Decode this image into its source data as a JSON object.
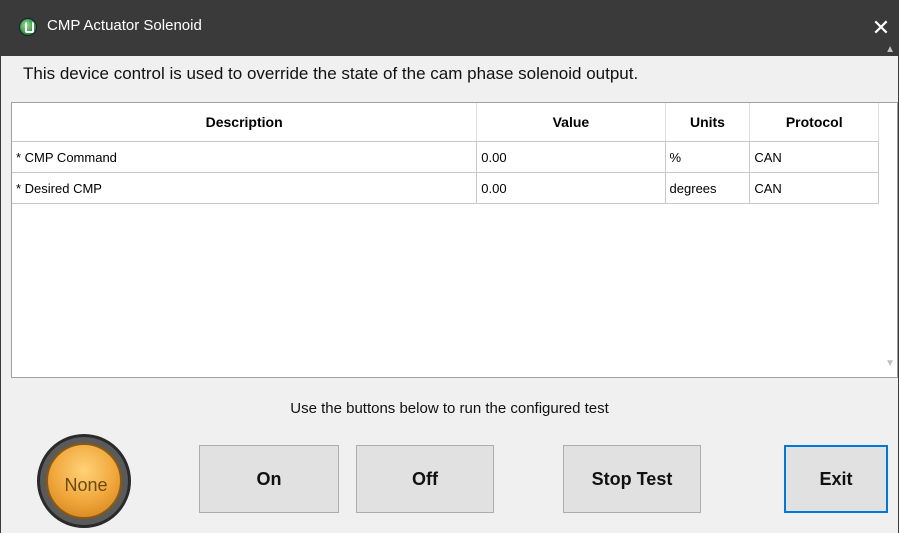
{
  "window": {
    "title": "CMP Actuator Solenoid",
    "close_glyph": "✕",
    "app_icon": "green-gauge-icon"
  },
  "info_text": "This device control is used to override the state of the cam phase solenoid output.",
  "grid": {
    "columns": [
      "Description",
      "Value",
      "Units",
      "Protocol"
    ],
    "rows": [
      {
        "description": "* CMP Command",
        "value": "0.00",
        "units": "%",
        "protocol": "CAN"
      },
      {
        "description": "* Desired CMP",
        "value": "0.00",
        "units": "degrees",
        "protocol": "CAN"
      }
    ]
  },
  "hint_text": "Use the buttons below to run the configured test",
  "status_light": {
    "label": "None",
    "color": "#f0a53a"
  },
  "buttons": {
    "on": "On",
    "off": "Off",
    "stop_test": "Stop Test",
    "exit": "Exit"
  },
  "colors": {
    "titlebar": "#3a3a3a",
    "focus": "#0078d7"
  }
}
